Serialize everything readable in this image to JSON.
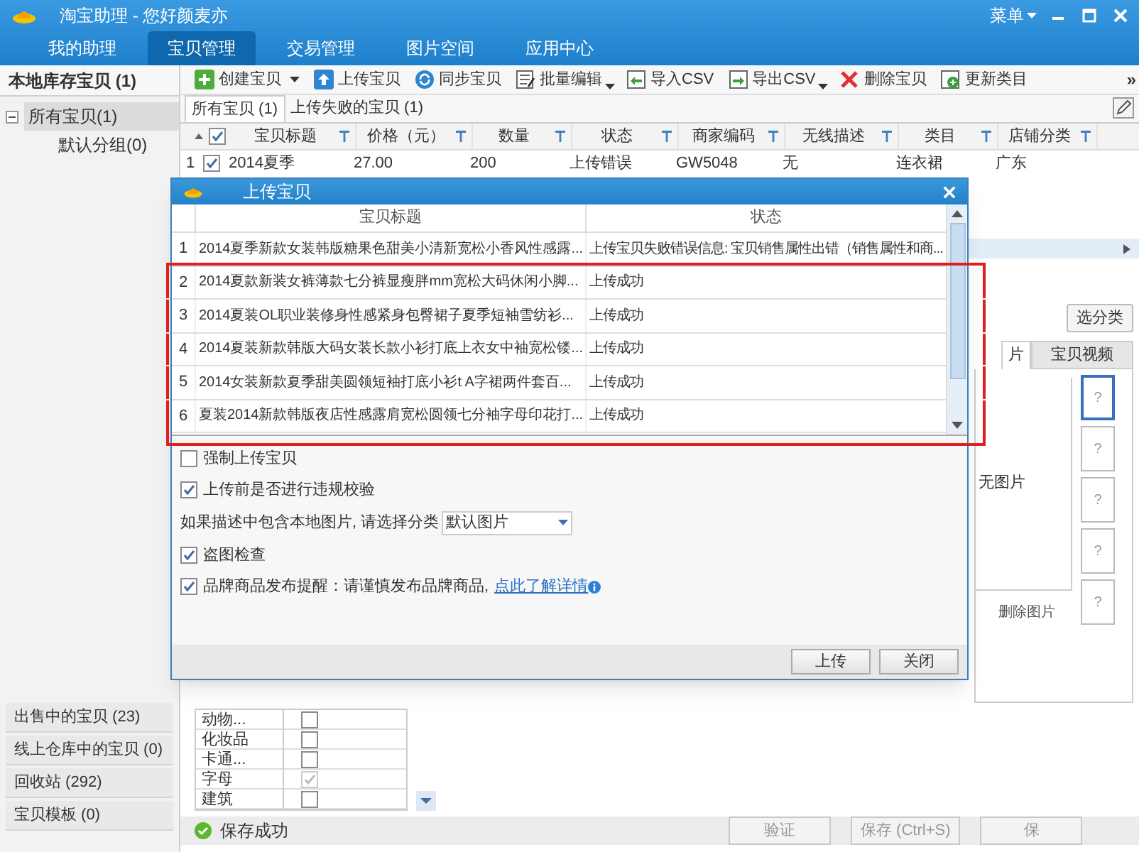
{
  "window": {
    "title": "淘宝助理 - 您好颜麦亦",
    "menu": "菜单"
  },
  "nav_tabs": [
    {
      "label": "我的助理",
      "selected": false
    },
    {
      "label": "宝贝管理",
      "selected": true
    },
    {
      "label": "交易管理",
      "selected": false
    },
    {
      "label": "图片空间",
      "selected": false
    },
    {
      "label": "应用中心",
      "selected": false
    }
  ],
  "sidebar": {
    "header": "本地库存宝贝 (1)",
    "tree": [
      {
        "label": "所有宝贝(1)",
        "selected": true,
        "expanded": true,
        "children": [
          {
            "label": "默认分组(0)",
            "selected": false
          }
        ]
      }
    ],
    "bottom_items": [
      "出售中的宝贝 (23)",
      "线上仓库中的宝贝 (0)",
      "回收站 (292)",
      "宝贝模板 (0)"
    ]
  },
  "toolbar": [
    {
      "label": "创建宝贝",
      "dropdown": true
    },
    {
      "label": "上传宝贝",
      "dropdown": false
    },
    {
      "label": "同步宝贝",
      "dropdown": false
    },
    {
      "label": "批量编辑",
      "dropdown": true
    },
    {
      "label": "导入CSV",
      "dropdown": false
    },
    {
      "label": "导出CSV",
      "dropdown": true
    },
    {
      "label": "删除宝贝",
      "dropdown": false
    },
    {
      "label": "更新类目",
      "dropdown": false
    }
  ],
  "toolbar_more": "»",
  "item_tabs": [
    {
      "label": "所有宝贝 (1)",
      "selected": true
    },
    {
      "label": "上传失败的宝贝 (1)",
      "selected": false
    }
  ],
  "table": {
    "header_checked": true,
    "columns": [
      "宝贝标题",
      "价格（元）",
      "数量",
      "状态",
      "商家编码",
      "无线描述",
      "类目",
      "店铺分类"
    ],
    "rows": [
      {
        "number": "1",
        "checked": true,
        "cells": [
          "2014夏季",
          "27.00",
          "200",
          "上传错误",
          "GW5048",
          "无",
          "连衣裙",
          "广东"
        ]
      }
    ]
  },
  "detail_panel": {
    "category_button": "选分类",
    "tabs": [
      {
        "label": "片",
        "selected": true
      },
      {
        "label": "宝贝视频",
        "selected": false
      }
    ],
    "no_image_text": "无图片",
    "thumbnails": [
      {
        "label": "?",
        "selected": true
      },
      {
        "label": "?",
        "selected": false
      },
      {
        "label": "?",
        "selected": false
      },
      {
        "label": "?",
        "selected": false
      },
      {
        "label": "?",
        "selected": false
      }
    ],
    "delete_image": "删除图片"
  },
  "category_list": [
    {
      "label": "动物...",
      "checked": false,
      "disabled": false
    },
    {
      "label": "化妆品",
      "checked": false,
      "disabled": false
    },
    {
      "label": "卡通...",
      "checked": false,
      "disabled": false
    },
    {
      "label": "字母",
      "checked": true,
      "disabled": true
    },
    {
      "label": "建筑",
      "checked": false,
      "disabled": false
    }
  ],
  "status_bar": {
    "message": "保存成功",
    "buttons": [
      "验证",
      "保存 (Ctrl+S)",
      "保"
    ]
  },
  "dialog": {
    "title": "上传宝贝",
    "columns": [
      "宝贝标题",
      "状态"
    ],
    "rows": [
      {
        "number": "1",
        "title": "2014夏季新款女装韩版糖果色甜美小清新宽松小香风性感露...",
        "status": "上传宝贝失败错误信息: 宝贝销售属性出错（销售属性和商...",
        "highlighted": false
      },
      {
        "number": "2",
        "title": "2014夏款新装女裤薄款七分裤显瘦胖mm宽松大码休闲小脚...",
        "status": "上传成功",
        "highlighted": true
      },
      {
        "number": "3",
        "title": "2014夏装OL职业装修身性感紧身包臀裙子夏季短袖雪纺衫...",
        "status": "上传成功",
        "highlighted": true
      },
      {
        "number": "4",
        "title": "2014夏装新款韩版大码女装长款小衫打底上衣女中袖宽松镂...",
        "status": "上传成功",
        "highlighted": true
      },
      {
        "number": "5",
        "title": "2014女装新款夏季甜美圆领短袖打底小衫t A字裙两件套百...",
        "status": "上传成功",
        "highlighted": true
      },
      {
        "number": "6",
        "title": "夏装2014新款韩版夜店性感露肩宽松圆领七分袖字母印花打...",
        "status": "上传成功",
        "highlighted": true
      }
    ],
    "options": [
      {
        "kind": "checkbox",
        "label": "强制上传宝贝",
        "checked": false
      },
      {
        "kind": "checkbox",
        "label": "上传前是否进行违规校验",
        "checked": true
      },
      {
        "kind": "select",
        "label": "如果描述中包含本地图片, 请选择分类",
        "value": "默认图片"
      },
      {
        "kind": "checkbox",
        "label": "盗图检查",
        "checked": true
      },
      {
        "kind": "checkbox",
        "label": "品牌商品发布提醒：请谨慎发布品牌商品,",
        "checked": true,
        "link": "点此了解详情"
      }
    ],
    "buttons": [
      "上传",
      "关闭"
    ]
  }
}
